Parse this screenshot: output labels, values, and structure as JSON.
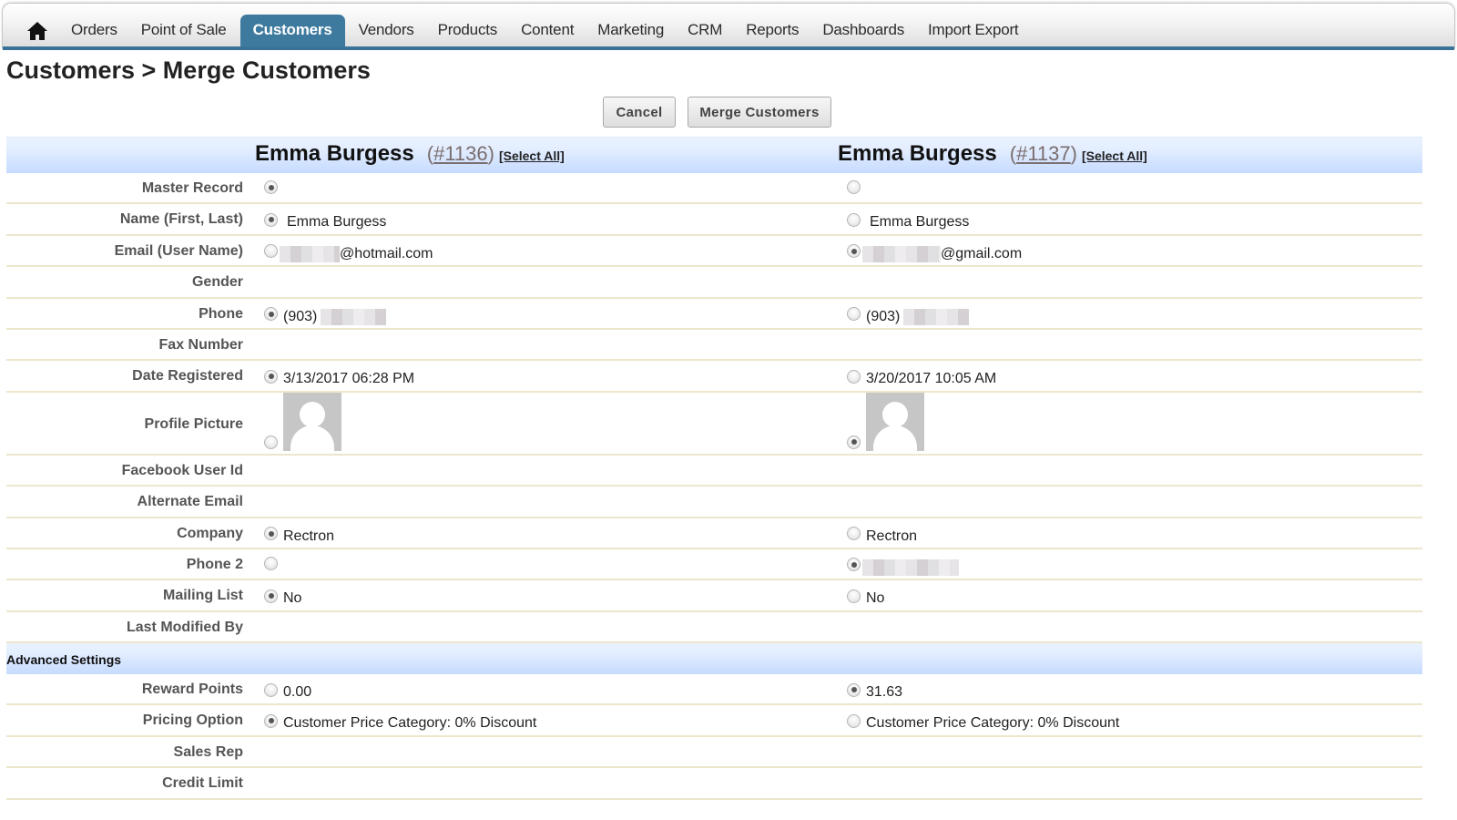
{
  "nav": {
    "home_icon": "home-icon",
    "items": [
      {
        "label": "Orders",
        "active": false
      },
      {
        "label": "Point of Sale",
        "active": false
      },
      {
        "label": "Customers",
        "active": true
      },
      {
        "label": "Vendors",
        "active": false
      },
      {
        "label": "Products",
        "active": false
      },
      {
        "label": "Content",
        "active": false
      },
      {
        "label": "Marketing",
        "active": false
      },
      {
        "label": "CRM",
        "active": false
      },
      {
        "label": "Reports",
        "active": false
      },
      {
        "label": "Dashboards",
        "active": false
      },
      {
        "label": "Import Export",
        "active": false
      }
    ],
    "accent_color": "#3d7a9e"
  },
  "page": {
    "title": "Customers > Merge Customers"
  },
  "actions": {
    "cancel_label": "Cancel",
    "merge_label": "Merge Customers"
  },
  "customers": {
    "left": {
      "name": "Emma Burgess",
      "id": "#1136",
      "select_all": "[Select All]"
    },
    "right": {
      "name": "Emma Burgess",
      "id": "#1137",
      "select_all": "[Select All]"
    }
  },
  "fields": [
    {
      "label": "Master Record",
      "left": {
        "radio": true,
        "checked": true,
        "value": ""
      },
      "right": {
        "radio": true,
        "checked": false,
        "value": ""
      }
    },
    {
      "label": "Name (First, Last)",
      "left": {
        "radio": true,
        "checked": true,
        "value": "Emma Burgess"
      },
      "right": {
        "radio": true,
        "checked": false,
        "value": "Emma Burgess"
      }
    },
    {
      "label": "Email (User Name)",
      "left": {
        "radio": true,
        "checked": false,
        "redacted": true,
        "value": "@hotmail.com"
      },
      "right": {
        "radio": true,
        "checked": true,
        "redacted": true,
        "value": "@gmail.com"
      }
    },
    {
      "label": "Gender",
      "left": null,
      "right": null
    },
    {
      "label": "Phone",
      "left": {
        "radio": true,
        "checked": true,
        "value": "(903)",
        "redacted_suffix": true
      },
      "right": {
        "radio": true,
        "checked": false,
        "value": "(903)",
        "redacted_suffix": true
      }
    },
    {
      "label": "Fax Number",
      "left": null,
      "right": null
    },
    {
      "label": "Date Registered",
      "left": {
        "radio": true,
        "checked": true,
        "value": "3/13/2017 06:28 PM"
      },
      "right": {
        "radio": true,
        "checked": false,
        "value": "3/20/2017 10:05 AM"
      }
    },
    {
      "label": "Profile Picture",
      "left": {
        "radio": true,
        "checked": false,
        "image": "default-avatar"
      },
      "right": {
        "radio": true,
        "checked": true,
        "image": "default-avatar"
      }
    },
    {
      "label": "Facebook User Id",
      "left": null,
      "right": null
    },
    {
      "label": "Alternate Email",
      "left": null,
      "right": null
    },
    {
      "label": "Company",
      "left": {
        "radio": true,
        "checked": true,
        "value": "Rectron"
      },
      "right": {
        "radio": true,
        "checked": false,
        "value": "Rectron"
      }
    },
    {
      "label": "Phone 2",
      "left": {
        "radio": true,
        "checked": false,
        "value": ""
      },
      "right": {
        "radio": true,
        "checked": true,
        "redacted": true,
        "value": ""
      }
    },
    {
      "label": "Mailing List",
      "left": {
        "radio": true,
        "checked": true,
        "value": "No"
      },
      "right": {
        "radio": true,
        "checked": false,
        "value": "No"
      }
    },
    {
      "label": "Last Modified By",
      "left": null,
      "right": null
    }
  ],
  "advanced": {
    "title": "Advanced Settings",
    "fields": [
      {
        "label": "Reward Points",
        "left": {
          "radio": true,
          "checked": false,
          "value": "0.00"
        },
        "right": {
          "radio": true,
          "checked": true,
          "value": "31.63"
        }
      },
      {
        "label": "Pricing Option",
        "left": {
          "radio": true,
          "checked": true,
          "value": "Customer Price Category: 0% Discount"
        },
        "right": {
          "radio": true,
          "checked": false,
          "value": "Customer Price Category: 0% Discount"
        }
      },
      {
        "label": "Sales Rep",
        "left": null,
        "right": null
      },
      {
        "label": "Credit Limit",
        "left": null,
        "right": null
      }
    ]
  }
}
